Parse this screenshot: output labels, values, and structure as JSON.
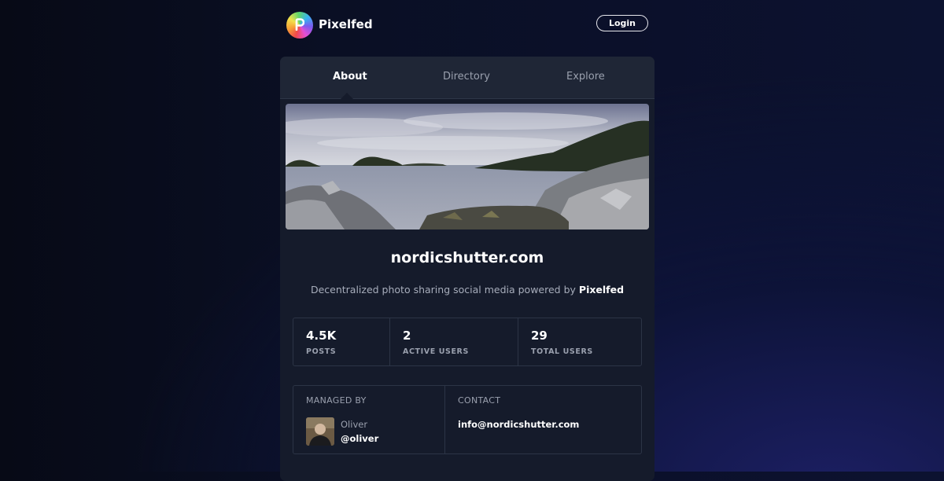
{
  "brand": {
    "name": "Pixelfed"
  },
  "header": {
    "login_label": "Login"
  },
  "tabs": [
    {
      "label": "About",
      "active": true
    },
    {
      "label": "Directory",
      "active": false
    },
    {
      "label": "Explore",
      "active": false
    }
  ],
  "instance": {
    "name": "nordicshutter.com",
    "description_prefix": "Decentralized photo sharing social media powered by ",
    "description_brand": "Pixelfed"
  },
  "stats": [
    {
      "value": "4.5K",
      "label": "POSTS"
    },
    {
      "value": "2",
      "label": "ACTIVE USERS"
    },
    {
      "value": "29",
      "label": "TOTAL USERS"
    }
  ],
  "managed_by": {
    "title": "MANAGED BY",
    "name": "Oliver",
    "handle": "@oliver"
  },
  "contact": {
    "title": "CONTACT",
    "email": "info@nordicshutter.com"
  },
  "colors": {
    "accent": "#ffffff",
    "card_bg": "#151b2b",
    "muted": "#9aa0ae"
  }
}
